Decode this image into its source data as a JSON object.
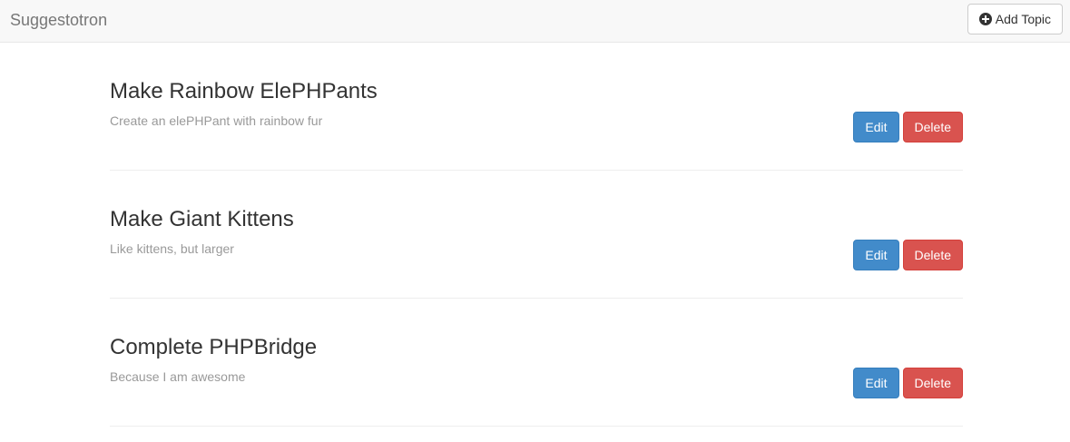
{
  "navbar": {
    "brand": "Suggestotron",
    "add_button_label": "Add Topic",
    "add_icon": "plus-circle-icon"
  },
  "topics": [
    {
      "title": "Make Rainbow ElePHPants",
      "description": "Create an elePHPant with rainbow fur",
      "edit_label": "Edit",
      "delete_label": "Delete"
    },
    {
      "title": "Make Giant Kittens",
      "description": "Like kittens, but larger",
      "edit_label": "Edit",
      "delete_label": "Delete"
    },
    {
      "title": "Complete PHPBridge",
      "description": "Because I am awesome",
      "edit_label": "Edit",
      "delete_label": "Delete"
    }
  ],
  "colors": {
    "edit": "#428bca",
    "delete": "#d9534f",
    "navbar_bg": "#f8f8f8"
  }
}
